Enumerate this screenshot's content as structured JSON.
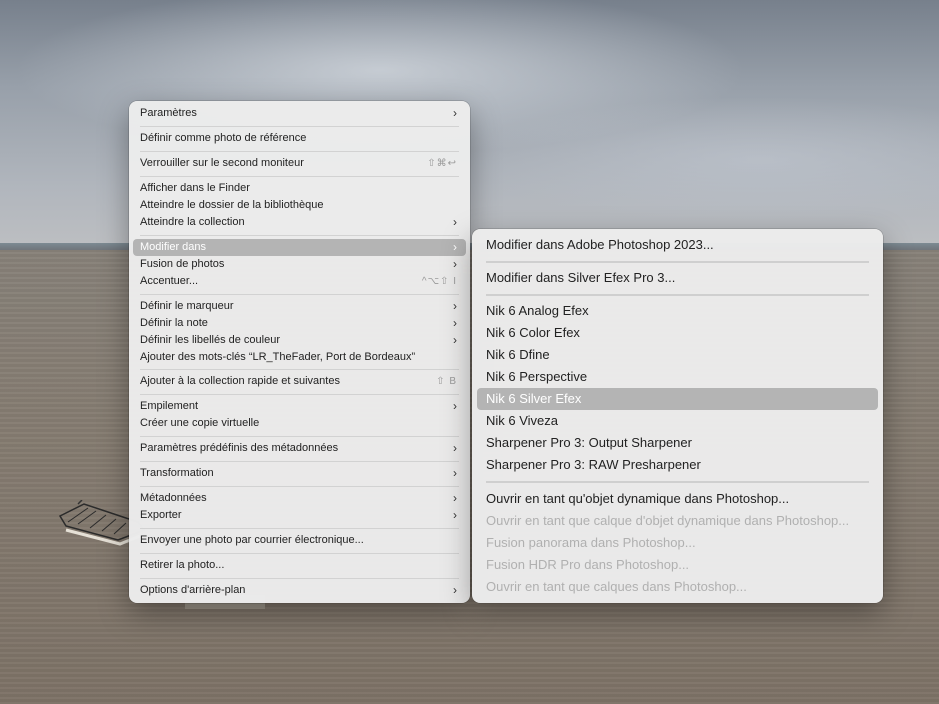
{
  "main_menu": {
    "items": [
      {
        "label": "Paramètres",
        "submenu": true
      },
      {
        "label": "Définir comme photo de référence"
      },
      {
        "label": "Verrouiller sur le second moniteur",
        "shortcut": "⇧⌘↩"
      },
      {
        "label": "Afficher dans le Finder"
      },
      {
        "label": "Atteindre le dossier de la bibliothèque"
      },
      {
        "label": "Atteindre la collection",
        "submenu": true
      },
      {
        "label": "Modifier dans",
        "submenu": true,
        "highlighted": true
      },
      {
        "label": "Fusion de photos",
        "submenu": true
      },
      {
        "label": "Accentuer...",
        "shortcut": "^⌥⇧ I"
      },
      {
        "label": "Définir le marqueur",
        "submenu": true
      },
      {
        "label": "Définir la note",
        "submenu": true
      },
      {
        "label": "Définir les libellés de couleur",
        "submenu": true
      },
      {
        "label": "Ajouter des mots-clés “LR_TheFader, Port de Bordeaux”"
      },
      {
        "label": "Ajouter à la collection rapide et suivantes",
        "shortcut": "⇧ B"
      },
      {
        "label": "Empilement",
        "submenu": true
      },
      {
        "label": "Créer une copie virtuelle"
      },
      {
        "label": "Paramètres prédéfinis des métadonnées",
        "submenu": true
      },
      {
        "label": "Transformation",
        "submenu": true
      },
      {
        "label": "Métadonnées",
        "submenu": true
      },
      {
        "label": "Exporter",
        "submenu": true
      },
      {
        "label": "Envoyer une photo par courrier électronique..."
      },
      {
        "label": "Retirer la photo..."
      },
      {
        "label": "Options d'arrière-plan",
        "submenu": true
      }
    ],
    "chevron": "›"
  },
  "sub_menu": {
    "items": [
      {
        "label": "Modifier dans Adobe Photoshop 2023..."
      },
      {
        "label": "Modifier dans Silver Efex Pro 3..."
      },
      {
        "label": "Nik 6 Analog Efex"
      },
      {
        "label": "Nik 6 Color Efex"
      },
      {
        "label": "Nik 6 Dfine"
      },
      {
        "label": "Nik 6 Perspective"
      },
      {
        "label": "Nik 6 Silver Efex",
        "highlighted": true
      },
      {
        "label": "Nik 6 Viveza"
      },
      {
        "label": "Sharpener Pro 3: Output Sharpener"
      },
      {
        "label": "Sharpener Pro 3: RAW Presharpener"
      },
      {
        "label": "Ouvrir en tant qu'objet dynamique dans Photoshop..."
      },
      {
        "label": "Ouvrir en tant que calque d'objet dynamique dans Photoshop...",
        "disabled": true
      },
      {
        "label": "Fusion panorama dans Photoshop...",
        "disabled": true
      },
      {
        "label": "Fusion HDR Pro dans Photoshop...",
        "disabled": true
      },
      {
        "label": "Ouvrir en tant que calques dans Photoshop...",
        "disabled": true
      }
    ]
  },
  "colors": {
    "menu_bg": "#ececec",
    "highlight": "#b4b4b4",
    "text": "#222222",
    "disabled_text": "#b0b0b0"
  },
  "icons": [
    "chevron-right-icon"
  ]
}
